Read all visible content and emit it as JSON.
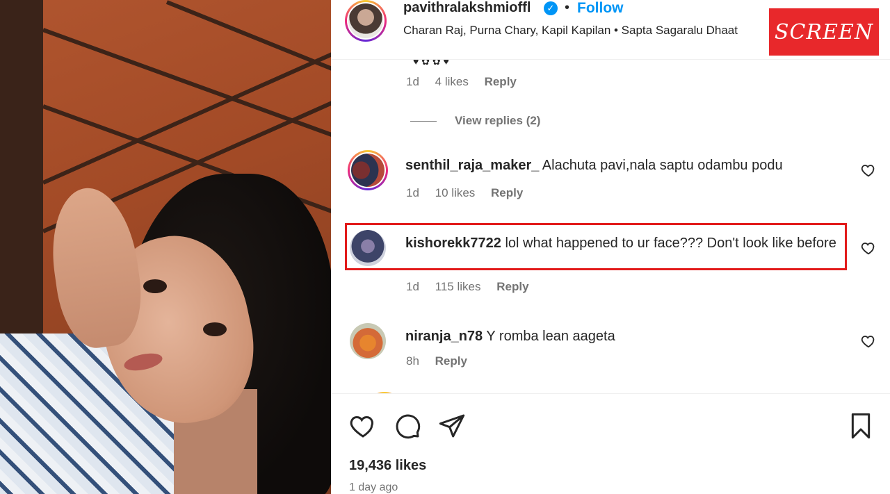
{
  "post": {
    "username": "pavithralakshmioffl",
    "verified_mark": "✓",
    "separator": "•",
    "follow_label": "Follow",
    "audio_line": "Charan Raj, Purna Chary, Kapil Kapilan • Sapta Sagaralu Dhaat"
  },
  "badge": {
    "label": "SCREEN",
    "color": "#e8282b"
  },
  "previous_comment": {
    "time": "1d",
    "likes": "4 likes",
    "reply": "Reply",
    "view_replies": "View replies (2)"
  },
  "comments": [
    {
      "user": "senthil_raja_maker_",
      "text": "Alachuta pavi,nala saptu odambu podu",
      "time": "1d",
      "likes": "10 likes",
      "reply": "Reply"
    },
    {
      "user": "kishorekk7722",
      "text": "lol what happened to ur face??? Don't look like before",
      "time": "1d",
      "likes": "115 likes",
      "reply": "Reply"
    },
    {
      "user": "niranja_n78",
      "text": "Y romba lean aageta",
      "time": "8h",
      "likes": "",
      "reply": "Reply"
    }
  ],
  "footer": {
    "likes": "19,436 likes",
    "posted": "1 day ago"
  },
  "colors": {
    "accent": "#0095f6",
    "highlight_box": "#e21b1b",
    "meta": "#737373"
  }
}
